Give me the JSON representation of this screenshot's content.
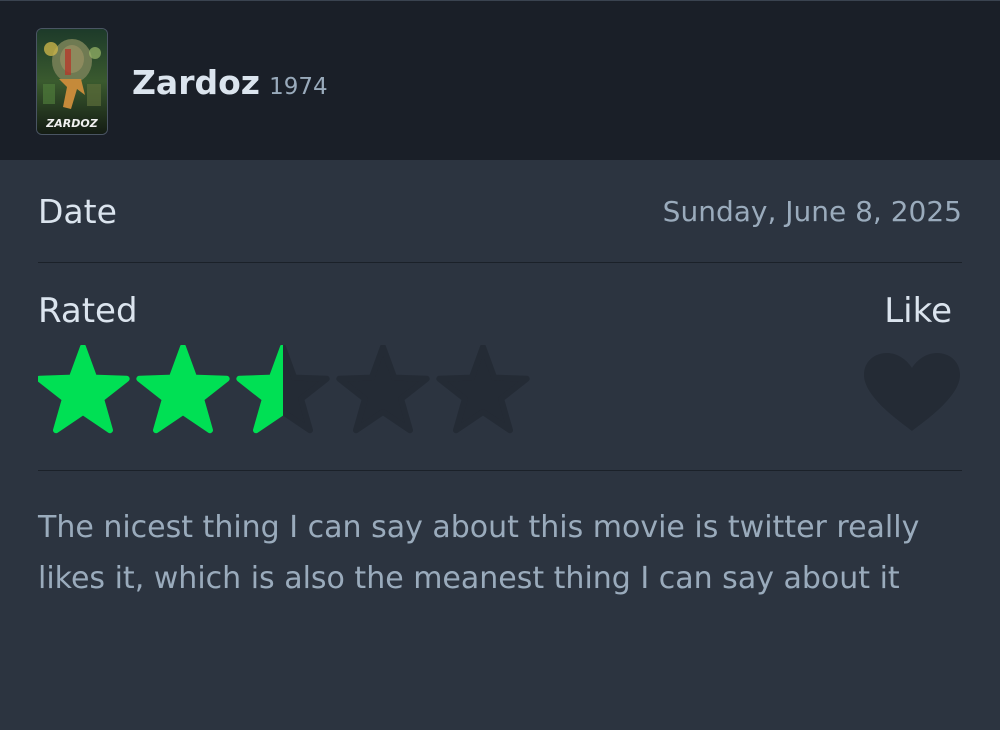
{
  "film": {
    "title": "Zardoz",
    "year": "1974",
    "poster_text": "ZARDOZ"
  },
  "date": {
    "label": "Date",
    "value": "Sunday, June 8, 2025"
  },
  "rating": {
    "label": "Rated",
    "value": 2.5,
    "max": 5,
    "filled_color": "#00e054",
    "empty_color": "#242b35"
  },
  "like": {
    "label": "Like",
    "liked": false,
    "icon": "heart-icon"
  },
  "review": {
    "text": "The nicest thing I can say about this movie is twitter really likes it, which is also the meanest thing I can say about it"
  },
  "colors": {
    "background": "#2c3440",
    "header": "#1a1f28"
  }
}
